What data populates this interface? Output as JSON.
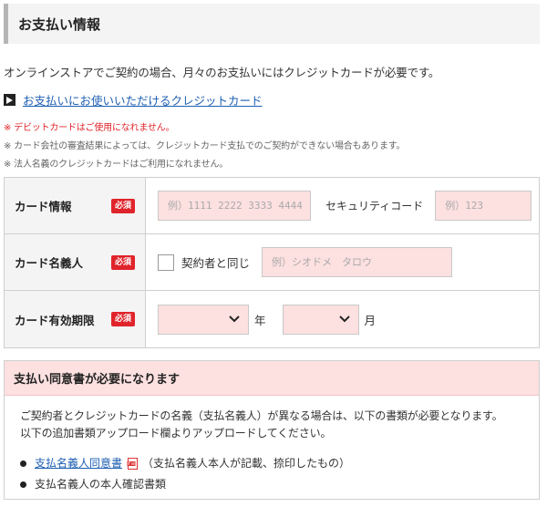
{
  "section": {
    "title": "お支払い情報",
    "intro": "オンラインストアでご契約の場合、月々のお支払いにはクレジットカードが必要です。",
    "card_link": "お支払いにお使いいただけるクレジットカード"
  },
  "notes": [
    "※ デビットカードはご使用になれません。",
    "※ カード会社の審査結果によっては、クレジットカード支払でのご契約ができない場合もあります。",
    "※ 法人名義のクレジットカードはご利用になれません。"
  ],
  "form": {
    "required_badge": "必須",
    "card_info": {
      "label": "カード情報",
      "number_placeholder": "例）1111 2222 3333 4444",
      "security_label": "セキュリティコード",
      "security_placeholder": "例）123"
    },
    "card_holder": {
      "label": "カード名義人",
      "same_as_contractor": "契約者と同じ",
      "name_placeholder": "例）シオドメ　タロウ"
    },
    "expiry": {
      "label": "カード有効期限",
      "year_unit": "年",
      "month_unit": "月"
    }
  },
  "consent": {
    "title": "支払い同意書が必要になります",
    "line1": "ご契約者とクレジットカードの名義（支払名義人）が異なる場合は、以下の書類が必要となります。",
    "line2": "以下の追加書類アップロード欄よりアップロードしてください。",
    "item1_link": "支払名義人同意書",
    "item1_note": "（支払名義人本人が記載、捺印したもの）",
    "item2": "支払名義人の本人確認書類"
  },
  "colors": {
    "required": "#e0242b",
    "input_bg": "#fde0e0",
    "link": "#1e5fb3"
  }
}
